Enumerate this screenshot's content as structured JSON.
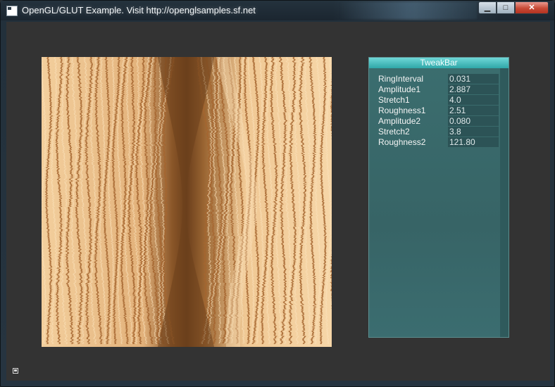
{
  "window": {
    "title": "OpenGL/GLUT Example. Visit http://openglsamples.sf.net",
    "minimize_glyph": "▁",
    "maximize_glyph": "□",
    "close_glyph": "✕",
    "colors": {
      "client_bg": "#333333",
      "close_red": "#c84a36"
    }
  },
  "tweakbar": {
    "title": "TweakBar",
    "params": [
      {
        "label": "RingInterval",
        "value": "0.031"
      },
      {
        "label": "Amplitude1",
        "value": "2.887"
      },
      {
        "label": "Stretch1",
        "value": "4.0"
      },
      {
        "label": "Roughness1",
        "value": "2.51"
      },
      {
        "label": "Amplitude2",
        "value": "0.080"
      },
      {
        "label": "Stretch2",
        "value": "3.8"
      },
      {
        "label": "Roughness2",
        "value": "121.80"
      }
    ],
    "colors": {
      "header": "#2fa7a8",
      "panel": "#3b6e6f",
      "value_bg": "#2c5356"
    }
  },
  "render": {
    "texture": "wood-grain",
    "colors": {
      "light": "#f6d6a8",
      "mid": "#d39a5e",
      "dark": "#6b3f1c"
    }
  }
}
